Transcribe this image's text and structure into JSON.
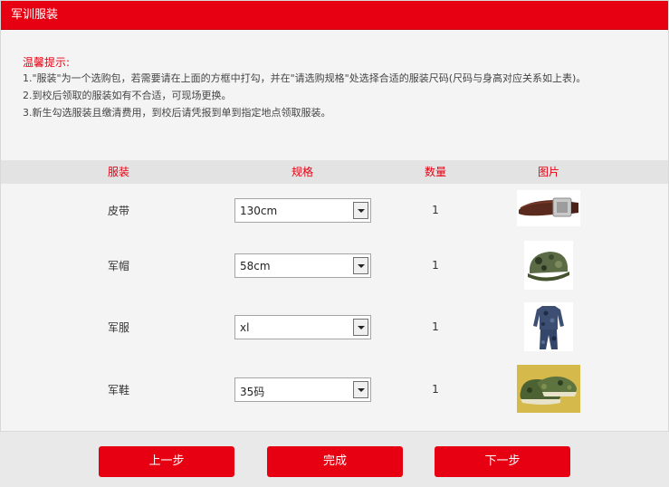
{
  "page": {
    "title": "军训服装"
  },
  "tips": {
    "title": "温馨提示:",
    "items": [
      "1.\"服装\"为一个选购包，若需要请在上面的方框中打勾，并在\"请选购规格\"处选择合适的服装尺码(尺码与身高对应关系如上表)。",
      "2.到校后领取的服装如有不合适，可现场更换。",
      "3.新生勾选服装且缴清费用，到校后请凭报到单到指定地点领取服装。"
    ]
  },
  "table": {
    "headers": [
      "服装",
      "规格",
      "数量",
      "图片"
    ],
    "rows": [
      {
        "name": "皮带",
        "spec": "130cm",
        "qty": "1",
        "image_icon": "belt-image"
      },
      {
        "name": "军帽",
        "spec": "58cm",
        "qty": "1",
        "image_icon": "camo-cap-image"
      },
      {
        "name": "军服",
        "spec": "xl",
        "qty": "1",
        "image_icon": "camo-uniform-image"
      },
      {
        "name": "军鞋",
        "spec": "35码",
        "qty": "1",
        "image_icon": "camo-shoes-image"
      }
    ]
  },
  "buttons": {
    "prev": "上一步",
    "finish": "完成",
    "next": "下一步"
  },
  "colors": {
    "accent": "#e60012",
    "header_bg": "#e3e3e3",
    "panel_bg": "#f4f4f4"
  }
}
